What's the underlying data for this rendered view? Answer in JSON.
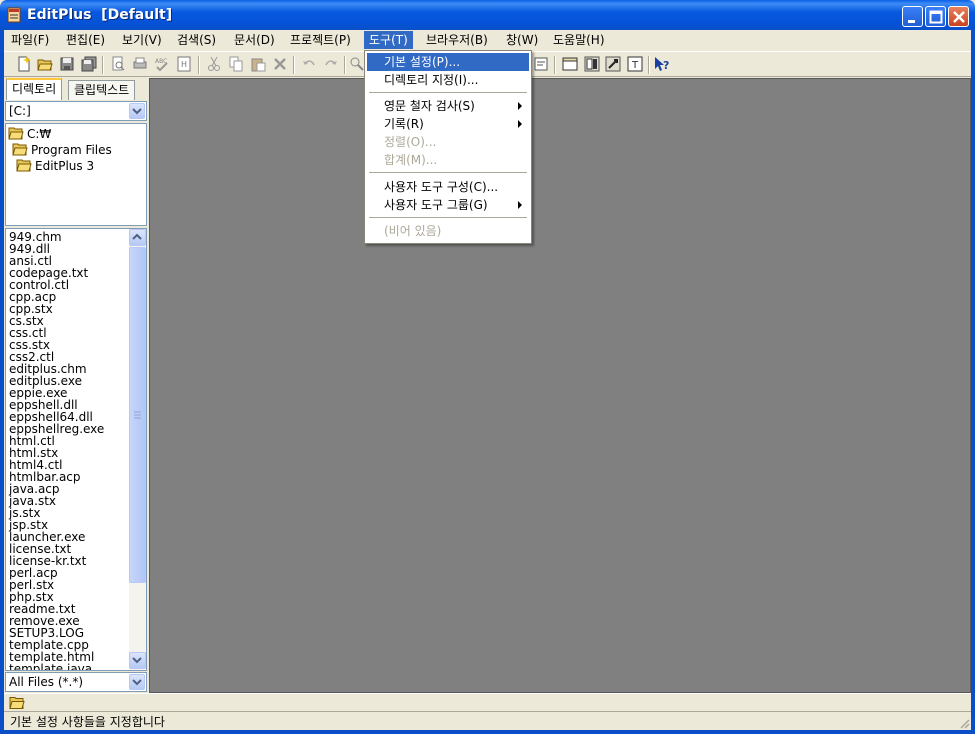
{
  "window": {
    "title": "EditPlus  [Default]"
  },
  "menubar": {
    "items": [
      "파일(F)",
      "편집(E)",
      "보기(V)",
      "검색(S)",
      "문서(D)",
      "프로젝트(P)",
      "도구(T)",
      "브라우저(B)",
      "창(W)",
      "도움말(H)"
    ],
    "active_index": 6
  },
  "tools_menu": {
    "items": [
      {
        "label": "기본 설정(P)...",
        "state": "highlighted"
      },
      {
        "label": "디렉토리 지정(I)...",
        "state": "normal"
      },
      {
        "label": "영문 철자 검사(S)",
        "state": "normal",
        "submenu": true
      },
      {
        "label": "기록(R)",
        "state": "normal",
        "submenu": true
      },
      {
        "label": "정렬(O)...",
        "state": "disabled"
      },
      {
        "label": "합계(M)...",
        "state": "disabled"
      },
      {
        "label": "사용자 도구 구성(C)...",
        "state": "normal"
      },
      {
        "label": "사용자 도구 그룹(G)",
        "state": "normal",
        "submenu": true
      },
      {
        "label": "(비어 있음)",
        "state": "disabled"
      }
    ]
  },
  "left_panel": {
    "tabs": [
      "디렉토리",
      "클립텍스트"
    ],
    "active_tab": 0,
    "drive": "[C:]",
    "tree": [
      "C:₩",
      "Program Files",
      "EditPlus 3"
    ],
    "files": [
      "949.chm",
      "949.dll",
      "ansi.ctl",
      "codepage.txt",
      "control.ctl",
      "cpp.acp",
      "cpp.stx",
      "cs.stx",
      "css.ctl",
      "css.stx",
      "css2.ctl",
      "editplus.chm",
      "editplus.exe",
      "eppie.exe",
      "eppshell.dll",
      "eppshell64.dll",
      "eppshellreg.exe",
      "html.ctl",
      "html.stx",
      "html4.ctl",
      "htmlbar.acp",
      "java.acp",
      "java.stx",
      "js.stx",
      "jsp.stx",
      "launcher.exe",
      "license.txt",
      "license-kr.txt",
      "perl.acp",
      "perl.stx",
      "php.stx",
      "readme.txt",
      "remove.exe",
      "SETUP3.LOG",
      "template.cpp",
      "template.html",
      "template.java"
    ],
    "filter": "All Files (*.*)"
  },
  "statusbar": {
    "text": "기본 설정 사항들을 지정합니다"
  },
  "colors": {
    "titlebar": "#0a54d9",
    "menu_highlight": "#316ac5",
    "workspace": "#808080",
    "chrome": "#ece9d8"
  },
  "icons": [
    "new-file-icon",
    "open-folder-icon",
    "save-icon",
    "save-all-icon",
    "print-preview-icon",
    "print-icon",
    "spell-check-icon",
    "html-icon",
    "cut-icon",
    "copy-icon",
    "paste-icon",
    "delete-icon",
    "undo-icon",
    "redo-icon",
    "find-icon",
    "wordwrap-icon",
    "directory-window-icon",
    "clip-icon",
    "browser-icon",
    "whats-this-icon"
  ]
}
